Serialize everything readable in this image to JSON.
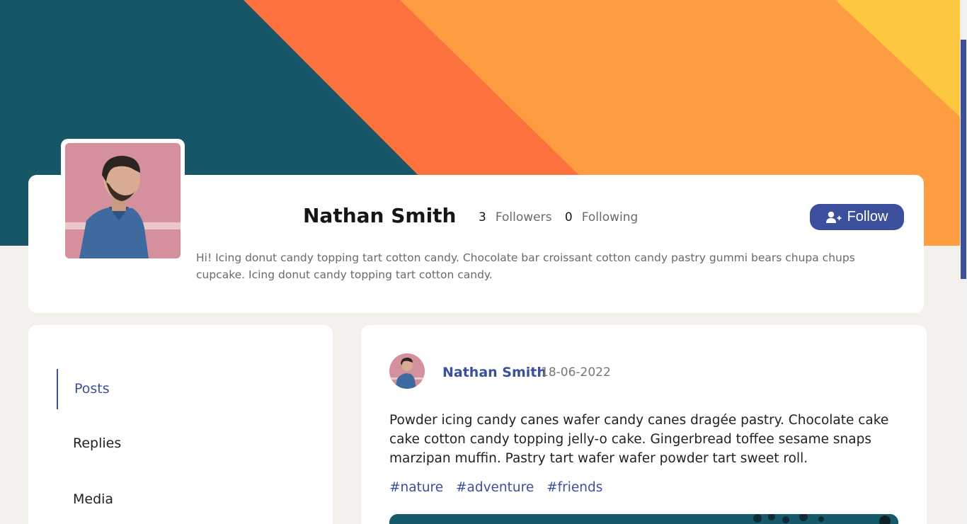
{
  "colors": {
    "accent": "#3b4f9c",
    "banner_teal": "#175667",
    "banner_red_orange": "#fd713f",
    "banner_orange": "#fd9c40",
    "banner_yellow": "#fdc73f",
    "page_background": "#f4f0ec"
  },
  "profile": {
    "name": "Nathan Smith",
    "followers_count": "3",
    "followers_label": "Followers",
    "following_count": "0",
    "following_label": "Following",
    "follow_label": "Follow",
    "follow_icon": "user-plus-icon",
    "bio": "Hi! Icing donut candy topping tart cotton candy. Chocolate bar croissant cotton candy pastry gummi bears chupa chups cupcake. Icing donut candy topping tart cotton candy."
  },
  "nav": {
    "items": [
      {
        "label": "Posts",
        "active": true
      },
      {
        "label": "Replies",
        "active": false
      },
      {
        "label": "Media",
        "active": false
      }
    ]
  },
  "post": {
    "author": "Nathan Smith",
    "date": "18-06-2022",
    "text": "Powder icing candy canes wafer candy canes dragée pastry. Chocolate cake cake cotton candy topping jelly-o cake. Gingerbread toffee sesame snaps marzipan muffin. Pastry tart wafer wafer powder tart sweet roll.",
    "tags": [
      "#nature",
      "#adventure",
      "#friends"
    ]
  }
}
